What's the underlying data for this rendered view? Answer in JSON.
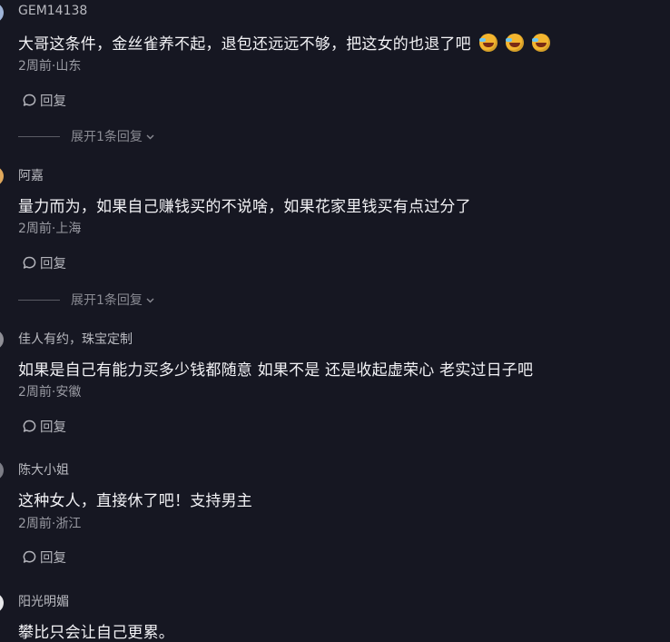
{
  "comments": [
    {
      "username": "GEM14138",
      "text": "大哥这条件，金丝雀养不起，退包还远远不够，把这女的也退了吧",
      "emojis": [
        "rolling-on-floor-laughing-emoji",
        "rolling-on-floor-laughing-emoji",
        "rolling-on-floor-laughing-emoji"
      ],
      "meta": "2周前·山东",
      "reply_label": "回复",
      "expand_label": "展开1条回复",
      "avatar_color": "#9fb4d8"
    },
    {
      "username": "阿嘉",
      "text": "量力而为，如果自己赚钱买的不说啥，如果花家里钱买有点过分了",
      "meta": "2周前·上海",
      "reply_label": "回复",
      "expand_label": "展开1条回复",
      "avatar_color": "#e0a85c"
    },
    {
      "username": "佳人有约，珠宝定制",
      "text": "如果是自己有能力买多少钱都随意 如果不是 还是收起虚荣心 老实过日子吧",
      "meta": "2周前·安徽",
      "reply_label": "回复",
      "avatar_color": "#8f8f96"
    },
    {
      "username": "陈大小姐",
      "text": "这种女人，直接休了吧！支持男主",
      "meta": "2周前·浙江",
      "reply_label": "回复",
      "avatar_color": "#7c7d86"
    },
    {
      "username": "阳光明媚",
      "text": "攀比只会让自己更累。",
      "avatar_color": "#e8e8ea"
    }
  ],
  "colors": {
    "background": "#161722",
    "text": "#f2f2f5",
    "secondary": "#9a9ba3"
  }
}
